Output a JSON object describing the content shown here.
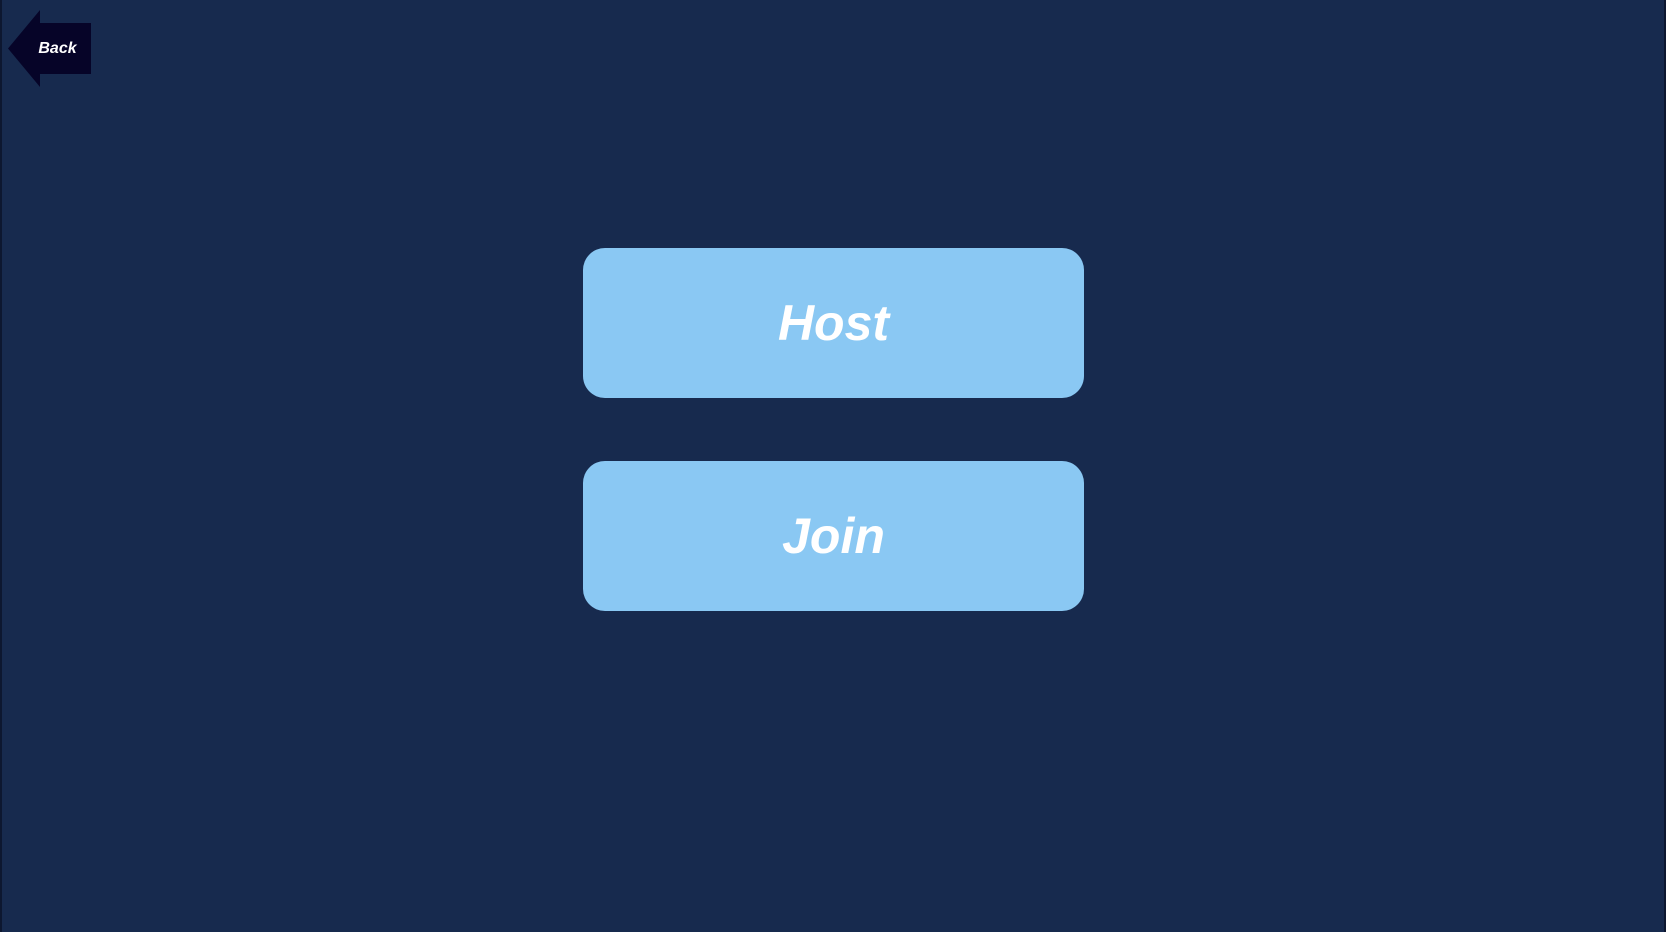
{
  "navigation": {
    "back_label": "Back",
    "back_icon": "left-arrow-icon"
  },
  "menu": {
    "host_label": "Host",
    "join_label": "Join"
  },
  "colors": {
    "background": "#172a4e",
    "button_fill": "#8ac8f3",
    "button_text": "#ffffff",
    "back_fill": "#060428"
  }
}
